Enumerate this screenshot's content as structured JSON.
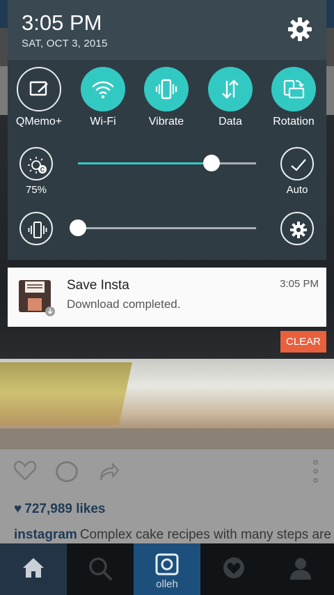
{
  "status_bar": {
    "time": "3:05 PM",
    "date": "SAT, OCT 3, 2015"
  },
  "quick_settings": {
    "tiles": [
      {
        "label": "QMemo+",
        "icon": "qmemo-icon",
        "active": false
      },
      {
        "label": "Wi-Fi",
        "icon": "wifi-icon",
        "active": true
      },
      {
        "label": "Vibrate",
        "icon": "vibrate-icon",
        "active": true
      },
      {
        "label": "Data",
        "icon": "data-icon",
        "active": true
      },
      {
        "label": "Rotation",
        "icon": "rotation-icon",
        "active": true
      }
    ],
    "brightness": {
      "value_label": "75%",
      "level": 0.75,
      "auto_label": "Auto"
    },
    "volume": {
      "level": 0.0
    }
  },
  "notification": {
    "app_name": "Save Insta",
    "text": "Download completed.",
    "time": "3:05 PM",
    "icon": "floppy-disk-icon"
  },
  "clear_label": "CLEAR",
  "background_app": {
    "likes": "727,989 likes",
    "caption_user": "instagram",
    "caption_text": "Complex cake recipes with many steps are",
    "camera_label": "olleh"
  },
  "colors": {
    "accent": "#33c9c3",
    "clear": "#e8603c",
    "shade": "#2f3c44"
  }
}
